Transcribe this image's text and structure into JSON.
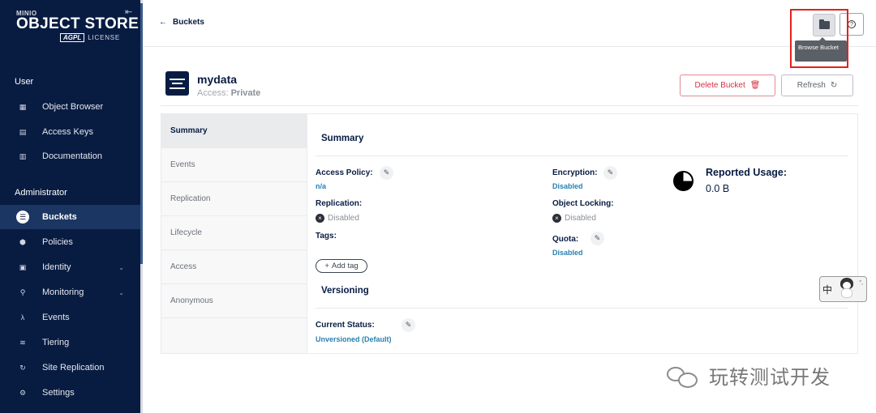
{
  "sidebar": {
    "logo": {
      "brand": "MINIO",
      "product": "OBJECT STORE",
      "license_badge": "AGPL",
      "license_text": "LICENSE"
    },
    "sections": [
      {
        "title": "User",
        "items": [
          {
            "label": "Object Browser",
            "icon": "object-browser-icon"
          },
          {
            "label": "Access Keys",
            "icon": "access-keys-icon"
          },
          {
            "label": "Documentation",
            "icon": "documentation-icon"
          }
        ]
      },
      {
        "title": "Administrator",
        "items": [
          {
            "label": "Buckets",
            "icon": "buckets-icon",
            "active": true
          },
          {
            "label": "Policies",
            "icon": "policies-icon"
          },
          {
            "label": "Identity",
            "icon": "identity-icon",
            "expandable": true
          },
          {
            "label": "Monitoring",
            "icon": "monitoring-icon",
            "expandable": true
          },
          {
            "label": "Events",
            "icon": "lambda-icon"
          },
          {
            "label": "Tiering",
            "icon": "tiering-icon"
          },
          {
            "label": "Site Replication",
            "icon": "site-replication-icon"
          },
          {
            "label": "Settings",
            "icon": "settings-icon"
          }
        ]
      }
    ]
  },
  "topbar": {
    "back_label": "Buckets",
    "tooltip": "Browse Bucket"
  },
  "bucket": {
    "name": "mydata",
    "access_label": "Access:",
    "access_value": "Private",
    "delete_label": "Delete Bucket",
    "refresh_label": "Refresh"
  },
  "tabs": [
    "Summary",
    "Events",
    "Replication",
    "Lifecycle",
    "Access",
    "Anonymous"
  ],
  "summary": {
    "title": "Summary",
    "access_policy_label": "Access Policy:",
    "access_policy_value": "n/a",
    "replication_label": "Replication:",
    "replication_value": "Disabled",
    "tags_label": "Tags:",
    "add_tag_label": "Add tag",
    "encryption_label": "Encryption:",
    "encryption_value": "Disabled",
    "object_locking_label": "Object Locking:",
    "object_locking_value": "Disabled",
    "quota_label": "Quota:",
    "quota_value": "Disabled",
    "usage_title": "Reported Usage:",
    "usage_value": "0.0 B"
  },
  "versioning": {
    "title": "Versioning",
    "status_label": "Current Status:",
    "status_value": "Unversioned (Default)"
  },
  "overlay": {
    "ime_char": "中",
    "ime_extra": "°,",
    "watermark_text": "玩转测试开发"
  },
  "colors": {
    "sidebar_bg": "#081c42",
    "active_item_bg": "#1c3663",
    "link": "#2781b0",
    "danger": "#d63244",
    "highlight_box": "#e3221c"
  }
}
